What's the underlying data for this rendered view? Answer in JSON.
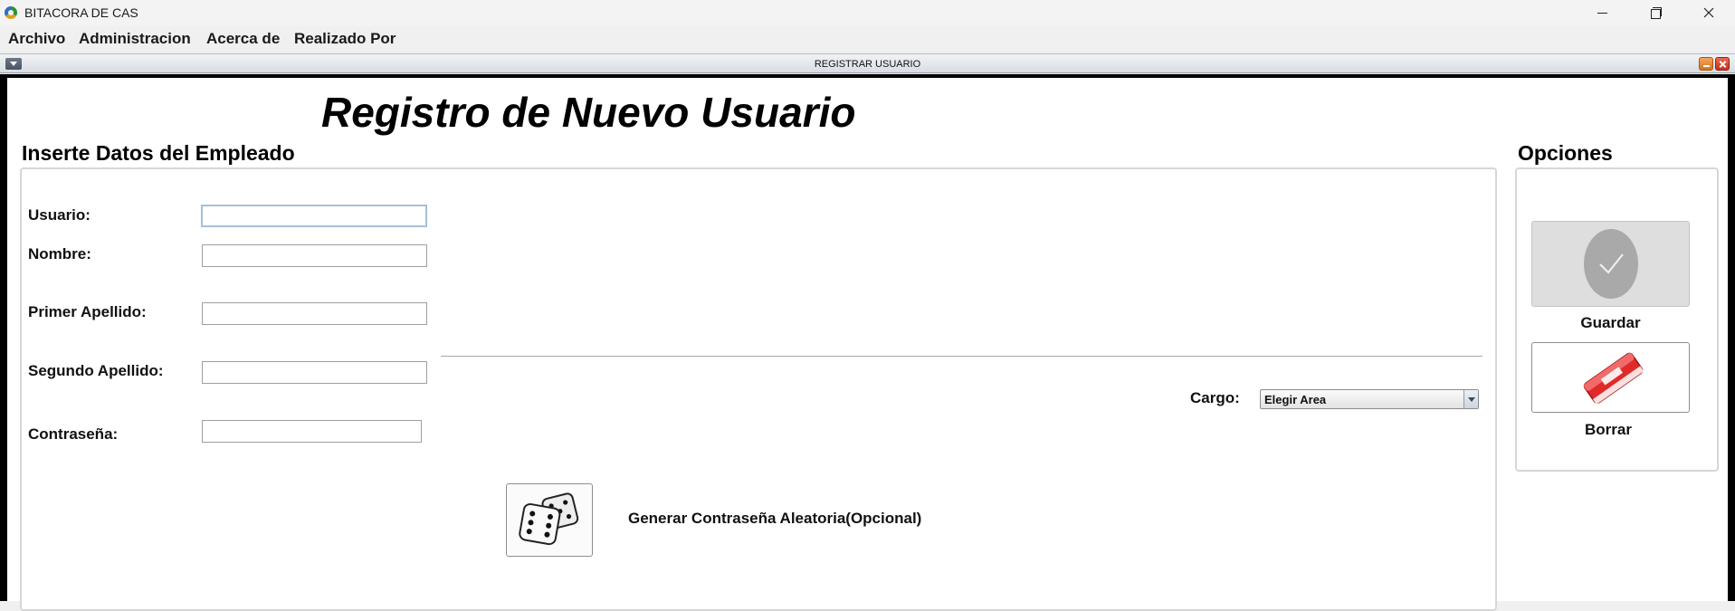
{
  "window": {
    "title": "BITACORA DE CAS",
    "app_icon": "app-globe-icon",
    "controls": [
      "minimize-icon",
      "restore-icon",
      "close-icon"
    ]
  },
  "menubar": {
    "items": [
      "Archivo",
      "Administracion",
      "Acerca de",
      "Realizado Por"
    ]
  },
  "internal_frame": {
    "title": "REGISTRAR USUARIO"
  },
  "form": {
    "main_title": "Registro de Nuevo Usuario",
    "section_title": "Inserte Datos del Empleado",
    "fields": [
      {
        "label": "Usuario:",
        "value": ""
      },
      {
        "label": "Nombre:",
        "value": ""
      },
      {
        "label": "Primer Apellido:",
        "value": ""
      },
      {
        "label": "Segundo Apellido:",
        "value": ""
      },
      {
        "label": "Contraseña:",
        "value": ""
      }
    ],
    "cargo_label": "Cargo:",
    "cargo_selected": "Elegir Area",
    "generate_password_label": "Generar Contraseña Aleatoria(Opcional)",
    "generate_icon": "dice-icon"
  },
  "options": {
    "title": "Opciones",
    "save_label": "Guardar",
    "save_icon": "checkmark-icon",
    "clear_label": "Borrar",
    "clear_icon": "eraser-icon"
  },
  "colors": {
    "frame_border": "#000000",
    "eraser_red": "#e02a2a",
    "save_disabled": "#a9a9a9"
  }
}
